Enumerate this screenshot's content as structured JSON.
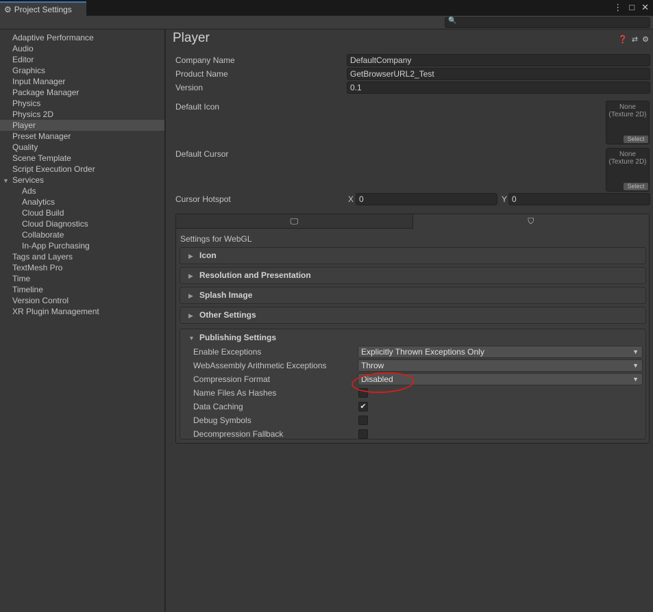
{
  "window": {
    "tab_title": "Project Settings",
    "controls": [
      "⋮",
      "□",
      "✕"
    ]
  },
  "search": {
    "placeholder": ""
  },
  "sidebar": {
    "items": [
      {
        "label": "Adaptive Performance",
        "level": 0
      },
      {
        "label": "Audio",
        "level": 0
      },
      {
        "label": "Editor",
        "level": 0
      },
      {
        "label": "Graphics",
        "level": 0
      },
      {
        "label": "Input Manager",
        "level": 0
      },
      {
        "label": "Package Manager",
        "level": 0
      },
      {
        "label": "Physics",
        "level": 0
      },
      {
        "label": "Physics 2D",
        "level": 0
      },
      {
        "label": "Player",
        "level": 0,
        "selected": true
      },
      {
        "label": "Preset Manager",
        "level": 0
      },
      {
        "label": "Quality",
        "level": 0
      },
      {
        "label": "Scene Template",
        "level": 0
      },
      {
        "label": "Script Execution Order",
        "level": 0
      },
      {
        "label": "Services",
        "level": 0,
        "expanded": true
      },
      {
        "label": "Ads",
        "level": 1
      },
      {
        "label": "Analytics",
        "level": 1
      },
      {
        "label": "Cloud Build",
        "level": 1
      },
      {
        "label": "Cloud Diagnostics",
        "level": 1
      },
      {
        "label": "Collaborate",
        "level": 1
      },
      {
        "label": "In-App Purchasing",
        "level": 1
      },
      {
        "label": "Tags and Layers",
        "level": 0
      },
      {
        "label": "TextMesh Pro",
        "level": 0
      },
      {
        "label": "Time",
        "level": 0
      },
      {
        "label": "Timeline",
        "level": 0
      },
      {
        "label": "Version Control",
        "level": 0
      },
      {
        "label": "XR Plugin Management",
        "level": 0
      }
    ]
  },
  "main": {
    "title": "Player",
    "company_label": "Company Name",
    "company_value": "DefaultCompany",
    "product_label": "Product Name",
    "product_value": "GetBrowserURL2_Test",
    "version_label": "Version",
    "version_value": "0.1",
    "default_icon_label": "Default Icon",
    "default_cursor_label": "Default Cursor",
    "slot_none": "None",
    "slot_type": "(Texture 2D)",
    "slot_select": "Select",
    "hotspot_label": "Cursor Hotspot",
    "x_label": "X",
    "x_value": "0",
    "y_label": "Y",
    "y_value": "0"
  },
  "platform": {
    "settings_for": "Settings for WebGL",
    "sections": [
      "Icon",
      "Resolution and Presentation",
      "Splash Image",
      "Other Settings"
    ],
    "publishing": {
      "title": "Publishing Settings",
      "enable_exceptions_label": "Enable Exceptions",
      "enable_exceptions_value": "Explicitly Thrown Exceptions Only",
      "wasm_label": "WebAssembly Arithmetic Exceptions",
      "wasm_value": "Throw",
      "compression_label": "Compression Format",
      "compression_value": "Disabled",
      "name_hashes_label": "Name Files As Hashes",
      "name_hashes_checked": false,
      "data_caching_label": "Data Caching",
      "data_caching_checked": true,
      "debug_symbols_label": "Debug Symbols",
      "debug_symbols_checked": false,
      "decompression_label": "Decompression Fallback",
      "decompression_checked": false
    }
  },
  "colors": {
    "accent": "#3a79bb",
    "annotation": "#d0201b",
    "background": "#383838"
  }
}
